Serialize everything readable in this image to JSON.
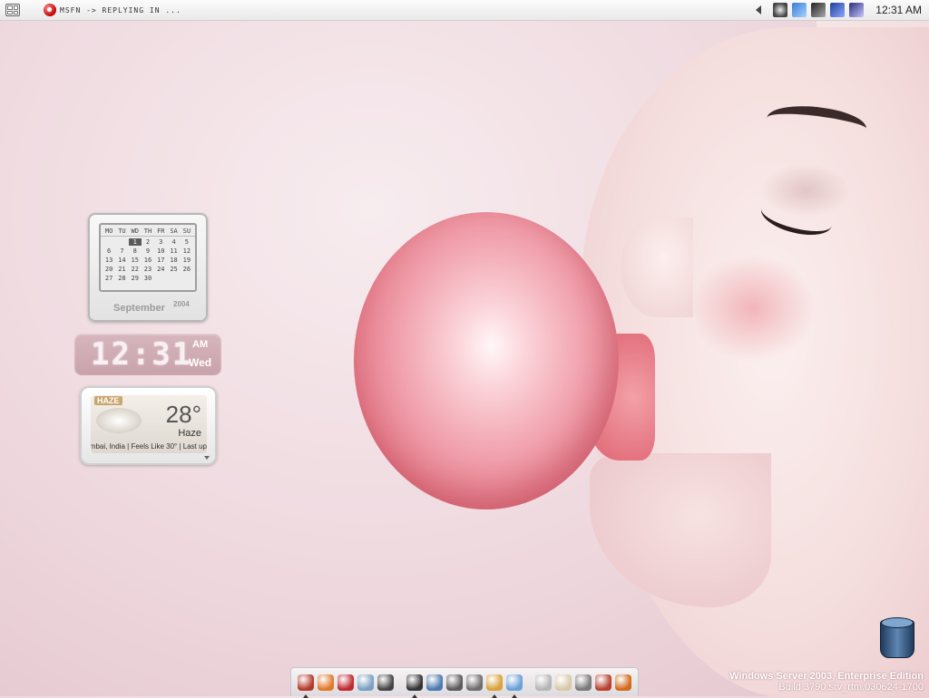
{
  "taskbar": {
    "active_task_label": "MSFN -> REPLYING IN ...",
    "clock": "12:31 AM",
    "tray_icons": [
      "alien-icon",
      "network-icon",
      "messenger-icon",
      "display-icon",
      "tools-icon"
    ]
  },
  "calendar": {
    "weekdays": [
      "MO",
      "TU",
      "WD",
      "TH",
      "FR",
      "SA",
      "SU"
    ],
    "month": "September",
    "year": "2004",
    "today": "1",
    "weeks": [
      [
        "",
        "",
        "1",
        "2",
        "3",
        "4",
        "5"
      ],
      [
        "6",
        "7",
        "8",
        "9",
        "10",
        "11",
        "12"
      ],
      [
        "13",
        "14",
        "15",
        "16",
        "17",
        "18",
        "19"
      ],
      [
        "20",
        "21",
        "22",
        "23",
        "24",
        "25",
        "26"
      ],
      [
        "27",
        "28",
        "29",
        "30",
        "",
        "",
        ""
      ]
    ]
  },
  "digital_clock": {
    "time": "12:31",
    "ampm": "AM",
    "day": "Wed"
  },
  "weather": {
    "tag": "HAZE",
    "temperature": "28°",
    "condition": "Haze",
    "ticker": "mbai, India | Feels Like 30° | Last up"
  },
  "dock": {
    "icons": [
      {
        "name": "firefox-orb-icon",
        "color": "#b23a2a",
        "running": true
      },
      {
        "name": "firefox-icon",
        "color": "#e0782a",
        "running": false
      },
      {
        "name": "mail-icon",
        "color": "#c0282e",
        "running": false
      },
      {
        "name": "globe-icon",
        "color": "#7b9fc4",
        "running": false
      },
      {
        "name": "media-reels-icon",
        "color": "#444444",
        "running": false
      },
      {
        "name": "gap",
        "color": "",
        "running": false
      },
      {
        "name": "speaker-icon",
        "color": "#333333",
        "running": true
      },
      {
        "name": "network-places-icon",
        "color": "#4c7ab0",
        "running": false
      },
      {
        "name": "folder-camera-icon",
        "color": "#5a5a5a",
        "running": false
      },
      {
        "name": "documents-icon",
        "color": "#6d6d6d",
        "running": false
      },
      {
        "name": "paint-icon",
        "color": "#d9a23c",
        "running": true
      },
      {
        "name": "snowman-icon",
        "color": "#6aa0d8",
        "running": true
      },
      {
        "name": "gap",
        "color": "",
        "running": false
      },
      {
        "name": "calendar-icon",
        "color": "#b5b5b5",
        "running": false
      },
      {
        "name": "scroll-icon",
        "color": "#d8c8a8",
        "running": false
      },
      {
        "name": "tools-icon",
        "color": "#7a7a7a",
        "running": false
      },
      {
        "name": "bottle-icon",
        "color": "#b8402e",
        "running": false
      },
      {
        "name": "flame-orb-icon",
        "color": "#d26a1c",
        "running": false
      }
    ]
  },
  "watermark": {
    "title": "Windows Server 2003, Enterprise Edition",
    "build": "Build 3790.srv_rtm.030624-1700"
  },
  "colors": {
    "bubble": "#ef9aa7",
    "background": "#eed8de"
  }
}
